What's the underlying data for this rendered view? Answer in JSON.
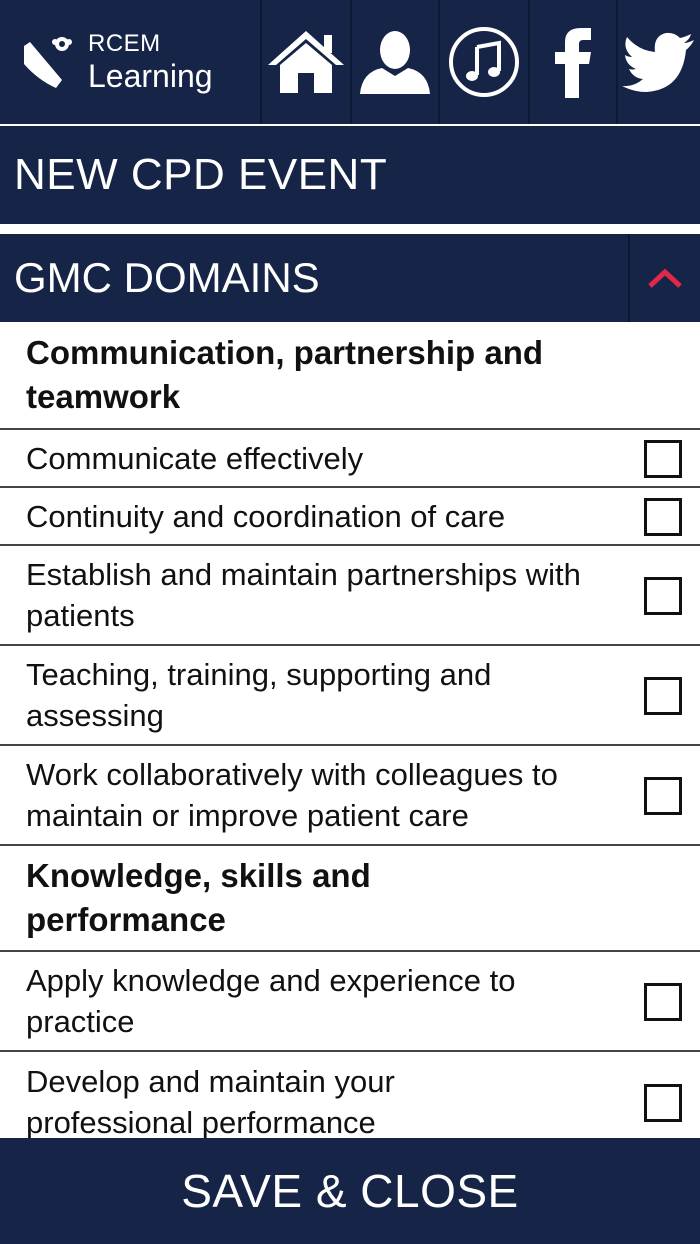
{
  "brand": {
    "line1": "RCEM",
    "line2": "Learning"
  },
  "nav_icons": [
    "home-icon",
    "profile-icon",
    "music-icon",
    "facebook-icon",
    "twitter-icon"
  ],
  "page_title": "NEW CPD EVENT",
  "section": {
    "title": "GMC DOMAINS",
    "toggle_icon": "chevron-up-icon",
    "accent_color": "#e0294a"
  },
  "groups": [
    {
      "title": "Communication, partnership and teamwork",
      "items": [
        {
          "label": "Communicate effectively",
          "checked": false
        },
        {
          "label": "Continuity and coordination of care",
          "checked": false
        },
        {
          "label": "Establish and maintain partnerships with patients",
          "checked": false
        },
        {
          "label": "Teaching, training, supporting and assessing",
          "checked": false
        },
        {
          "label": "Work collaboratively with colleagues to maintain or improve patient care",
          "checked": false
        }
      ]
    },
    {
      "title": "Knowledge, skills and performance",
      "items": [
        {
          "label": "Apply knowledge and experience to practice",
          "checked": false
        },
        {
          "label": "Develop and maintain your professional performance",
          "checked": false
        }
      ]
    }
  ],
  "save_button": "SAVE & CLOSE",
  "colors": {
    "navy": "#162447",
    "white": "#ffffff",
    "accent": "#e0294a"
  }
}
